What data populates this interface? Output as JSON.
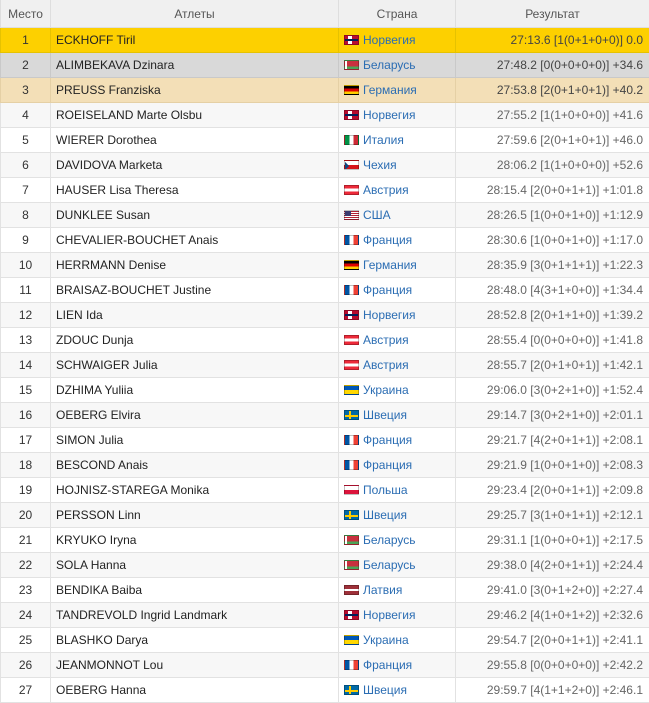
{
  "headers": {
    "place": "Место",
    "athletes": "Атлеты",
    "country": "Страна",
    "result": "Результат"
  },
  "rows": [
    {
      "place": "1",
      "name": "ECKHOFF Tiril",
      "country": "Норвегия",
      "flag": "norway-flag",
      "result": "27:13.6 [1(0+1+0+0)] 0.0"
    },
    {
      "place": "2",
      "name": "ALIMBEKAVA Dzinara",
      "country": "Беларусь",
      "flag": "belarus-flag",
      "result": "27:48.2 [0(0+0+0+0)] +34.6"
    },
    {
      "place": "3",
      "name": "PREUSS Franziska",
      "country": "Германия",
      "flag": "germany-flag",
      "result": "27:53.8 [2(0+1+0+1)] +40.2"
    },
    {
      "place": "4",
      "name": "ROEISELAND Marte Olsbu",
      "country": "Норвегия",
      "flag": "norway-flag",
      "result": "27:55.2 [1(1+0+0+0)] +41.6"
    },
    {
      "place": "5",
      "name": "WIERER Dorothea",
      "country": "Италия",
      "flag": "italy-flag",
      "result": "27:59.6 [2(0+1+0+1)] +46.0"
    },
    {
      "place": "6",
      "name": "DAVIDOVA Marketa",
      "country": "Чехия",
      "flag": "czech-flag",
      "result": "28:06.2 [1(1+0+0+0)] +52.6"
    },
    {
      "place": "7",
      "name": "HAUSER Lisa Theresa",
      "country": "Австрия",
      "flag": "austria-flag",
      "result": "28:15.4 [2(0+0+1+1)] +1:01.8"
    },
    {
      "place": "8",
      "name": "DUNKLEE Susan",
      "country": "США",
      "flag": "usa-flag",
      "result": "28:26.5 [1(0+0+1+0)] +1:12.9"
    },
    {
      "place": "9",
      "name": "CHEVALIER-BOUCHET Anais",
      "country": "Франция",
      "flag": "france-flag",
      "result": "28:30.6 [1(0+0+1+0)] +1:17.0"
    },
    {
      "place": "10",
      "name": "HERRMANN Denise",
      "country": "Германия",
      "flag": "germany-flag",
      "result": "28:35.9 [3(0+1+1+1)] +1:22.3"
    },
    {
      "place": "11",
      "name": "BRAISAZ-BOUCHET Justine",
      "country": "Франция",
      "flag": "france-flag",
      "result": "28:48.0 [4(3+1+0+0)] +1:34.4"
    },
    {
      "place": "12",
      "name": "LIEN Ida",
      "country": "Норвегия",
      "flag": "norway-flag",
      "result": "28:52.8 [2(0+1+1+0)] +1:39.2"
    },
    {
      "place": "13",
      "name": "ZDOUC Dunja",
      "country": "Австрия",
      "flag": "austria-flag",
      "result": "28:55.4 [0(0+0+0+0)] +1:41.8"
    },
    {
      "place": "14",
      "name": "SCHWAIGER Julia",
      "country": "Австрия",
      "flag": "austria-flag",
      "result": "28:55.7 [2(0+1+0+1)] +1:42.1"
    },
    {
      "place": "15",
      "name": "DZHIMA Yuliia",
      "country": "Украина",
      "flag": "ukraine-flag",
      "result": "29:06.0 [3(0+2+1+0)] +1:52.4"
    },
    {
      "place": "16",
      "name": "OEBERG Elvira",
      "country": "Швеция",
      "flag": "sweden-flag",
      "result": "29:14.7 [3(0+2+1+0)] +2:01.1"
    },
    {
      "place": "17",
      "name": "SIMON Julia",
      "country": "Франция",
      "flag": "france-flag",
      "result": "29:21.7 [4(2+0+1+1)] +2:08.1"
    },
    {
      "place": "18",
      "name": "BESCOND Anais",
      "country": "Франция",
      "flag": "france-flag",
      "result": "29:21.9 [1(0+0+1+0)] +2:08.3"
    },
    {
      "place": "19",
      "name": "HOJNISZ-STAREGA Monika",
      "country": "Польша",
      "flag": "poland-flag",
      "result": "29:23.4 [2(0+0+1+1)] +2:09.8"
    },
    {
      "place": "20",
      "name": "PERSSON Linn",
      "country": "Швеция",
      "flag": "sweden-flag",
      "result": "29:25.7 [3(1+0+1+1)] +2:12.1"
    },
    {
      "place": "21",
      "name": "KRYUKO Iryna",
      "country": "Беларусь",
      "flag": "belarus-flag",
      "result": "29:31.1 [1(0+0+0+1)] +2:17.5"
    },
    {
      "place": "22",
      "name": "SOLA Hanna",
      "country": "Беларусь",
      "flag": "belarus-flag",
      "result": "29:38.0 [4(2+0+1+1)] +2:24.4"
    },
    {
      "place": "23",
      "name": "BENDIKA Baiba",
      "country": "Латвия",
      "flag": "latvia-flag",
      "result": "29:41.0 [3(0+1+2+0)] +2:27.4"
    },
    {
      "place": "24",
      "name": "TANDREVOLD Ingrid Landmark",
      "country": "Норвегия",
      "flag": "norway-flag",
      "result": "29:46.2 [4(1+0+1+2)] +2:32.6"
    },
    {
      "place": "25",
      "name": "BLASHKO Darya",
      "country": "Украина",
      "flag": "ukraine-flag",
      "result": "29:54.7 [2(0+0+1+1)] +2:41.1"
    },
    {
      "place": "26",
      "name": "JEANMONNOT Lou",
      "country": "Франция",
      "flag": "france-flag",
      "result": "29:55.8 [0(0+0+0+0)] +2:42.2"
    },
    {
      "place": "27",
      "name": "OEBERG Hanna",
      "country": "Швеция",
      "flag": "sweden-flag",
      "result": "29:59.7 [4(1+1+2+0)] +2:46.1"
    }
  ]
}
